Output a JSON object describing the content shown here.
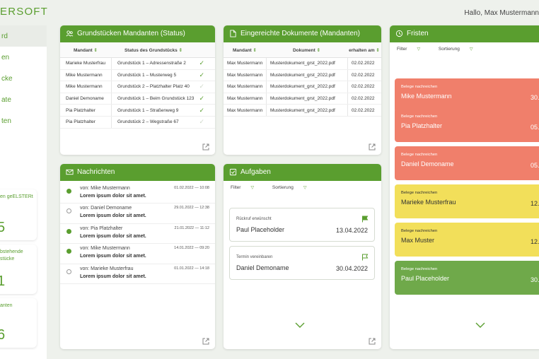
{
  "brand": {
    "logo_text": "ERSOFT"
  },
  "header": {
    "greeting": "Hallo, Max Mustermann"
  },
  "sidebar": {
    "items": [
      {
        "label": "rd",
        "active": true
      },
      {
        "label": "en"
      },
      {
        "label": "cke"
      },
      {
        "label": "ate"
      },
      {
        "label": "ten"
      }
    ],
    "stats": [
      {
        "label": "en geELSTERt",
        "value": "5"
      },
      {
        "label": "bstehende\nstücke",
        "value": "1"
      },
      {
        "label": "anten",
        "value": "6"
      }
    ]
  },
  "grundstuecke": {
    "title": "Grundstücken Mandanten (Status)",
    "columns": [
      "Mandant",
      "Status des Grundstücks"
    ],
    "rows": [
      {
        "mandant": "Marieke Musterfrau",
        "status": "Grundstück 1 – Adressenstraße 2",
        "done": true
      },
      {
        "mandant": "Mike Mustermann",
        "status": "Grundstück 1 – Musterweg 5",
        "done": true
      },
      {
        "mandant": "Mike Mustermann",
        "status": "Grundstück 2 – Platzhalter Platz 40",
        "done": false
      },
      {
        "mandant": "Daniel Demoname",
        "status": "Grundstück 1 – Beim Grundstück 123",
        "done": true
      },
      {
        "mandant": "Pia Platzhalter",
        "status": "Grundstück 1 – Straßenweg 9",
        "done": true
      },
      {
        "mandant": "Pia Platzhalter",
        "status": "Grundstück 2 – Wegstraße 67",
        "done": false
      }
    ]
  },
  "dokumente": {
    "title": "Eingereichte Dokumente (Mandanten)",
    "columns": [
      "Mandant",
      "Dokument",
      "erhalten am"
    ],
    "rows": [
      {
        "mandant": "Max Mustermann",
        "dokument": "Musterdokument_grst_2022.pdf",
        "date": "02.02.2022"
      },
      {
        "mandant": "Max Mustermann",
        "dokument": "Musterdokument_grst_2022.pdf",
        "date": "02.02.2022"
      },
      {
        "mandant": "Max Mustermann",
        "dokument": "Musterdokument_grst_2022.pdf",
        "date": "02.02.2022"
      },
      {
        "mandant": "Max Mustermann",
        "dokument": "Musterdokument_grst_2022.pdf",
        "date": "02.02.2022"
      },
      {
        "mandant": "Max Mustermann",
        "dokument": "Musterdokument_grst_2022.pdf",
        "date": "02.02.2022"
      }
    ]
  },
  "fristen": {
    "title": "Fristen",
    "filter_label": "Filter",
    "sort_label": "Sortierung",
    "cards": [
      {
        "label": "Belege nachreichen",
        "name": "Mike Mustermann",
        "date": "30.",
        "color": "red"
      },
      {
        "label": "Belege nachreichen",
        "name": "Pia Platzhalter",
        "date": "05.",
        "color": "red"
      },
      {
        "label": "Belege nachreichen",
        "name": "Daniel Demoname",
        "date": "05.",
        "color": "red"
      },
      {
        "label": "Belege nachreichen",
        "name": "Marieke Musterfrau",
        "date": "12.",
        "color": "yellow"
      },
      {
        "label": "Belege nachreichen",
        "name": "Max Muster",
        "date": "12.",
        "color": "yellow"
      },
      {
        "label": "Belege nachreichen",
        "name": "Paul Placeholder",
        "date": "30.",
        "color": "green"
      }
    ]
  },
  "nachrichten": {
    "title": "Nachrichten",
    "messages": [
      {
        "from": "von: Mike Mustermann",
        "body": "Lorem ipsum dolor sit amet.",
        "date": "01.02.2022 — 10:08",
        "unread": true
      },
      {
        "from": "von: Daniel Demoname",
        "body": "Lorem ipsum dolor sit amet.",
        "date": "29.01.2022 — 12:38",
        "unread": false
      },
      {
        "from": "von: Pia Platzhalter",
        "body": "Lorem ipsum dolor sit amet.",
        "date": "21.01.2022 — 11:12",
        "unread": true
      },
      {
        "from": "von: Mike Mustermann",
        "body": "Lorem ipsum dolor sit amet.",
        "date": "14.01.2022 — 09:20",
        "unread": true
      },
      {
        "from": "von: Marieke Musterfrau",
        "body": "Lorem ipsum dolor sit amet.",
        "date": "01.01.2022 — 14:18",
        "unread": false
      }
    ]
  },
  "aufgaben": {
    "title": "Aufgaben",
    "filter_label": "Filter",
    "sort_label": "Sortierung",
    "tasks": [
      {
        "label": "Rückruf erwünscht",
        "name": "Paul Placeholder",
        "date": "13.04.2022",
        "flagged": true
      },
      {
        "label": "Termin vereinbaren",
        "name": "Daniel Demoname",
        "date": "30.04.2022",
        "flagged": false
      }
    ]
  },
  "colors": {
    "accent": "#5a9e2f",
    "red": "#f07f6b",
    "yellow": "#f2df5a",
    "green": "#6fa94a"
  },
  "icons": {
    "grundstuecke": "people-icon",
    "dokumente": "document-icon",
    "nachrichten": "mail-icon",
    "aufgaben": "checkbox-icon",
    "fristen": "clock-icon",
    "external": "external-link-icon",
    "sort": "sort-arrows-icon",
    "chevron": "chevron-down-icon"
  }
}
